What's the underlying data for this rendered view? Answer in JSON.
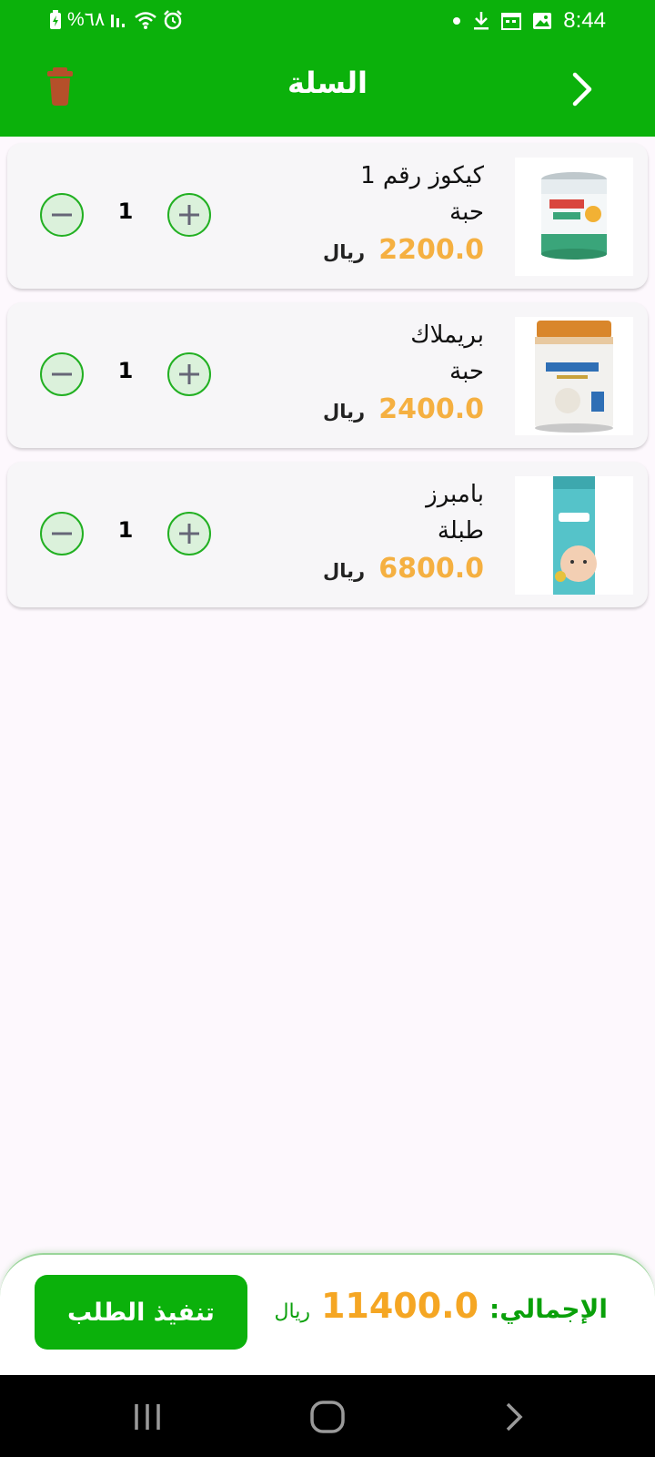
{
  "status_bar": {
    "battery": "%٦٨",
    "time": "8:44",
    "left_icons": [
      "battery-charging-icon",
      "signal-icon",
      "wifi-icon",
      "alarm-icon"
    ],
    "right_icons": [
      "dot-icon",
      "download-icon",
      "calendar-icon",
      "image-icon"
    ]
  },
  "header": {
    "title": "السلة",
    "back_icon": "chevron-right-icon",
    "delete_icon": "trash-icon",
    "background": "#0bb10b"
  },
  "cart": {
    "items": [
      {
        "name": "كيكوز رقم 1",
        "unit": "حبة",
        "price": "2200.0",
        "currency": "ريال",
        "quantity": "1"
      },
      {
        "name": "بريملاك",
        "unit": "حبة",
        "price": "2400.0",
        "currency": "ريال",
        "quantity": "1"
      },
      {
        "name": "بامبرز",
        "unit": "طبلة",
        "price": "6800.0",
        "currency": "ريال",
        "quantity": "1"
      }
    ]
  },
  "footer": {
    "total_label": "الإجمالي:",
    "total_value": "11400.0",
    "currency": "ريال",
    "checkout_label": "تنفيذ الطلب"
  },
  "colors": {
    "primary": "#0bb10b",
    "price": "#f5b041",
    "total": "#f5a623",
    "trash": "#b5502a"
  }
}
